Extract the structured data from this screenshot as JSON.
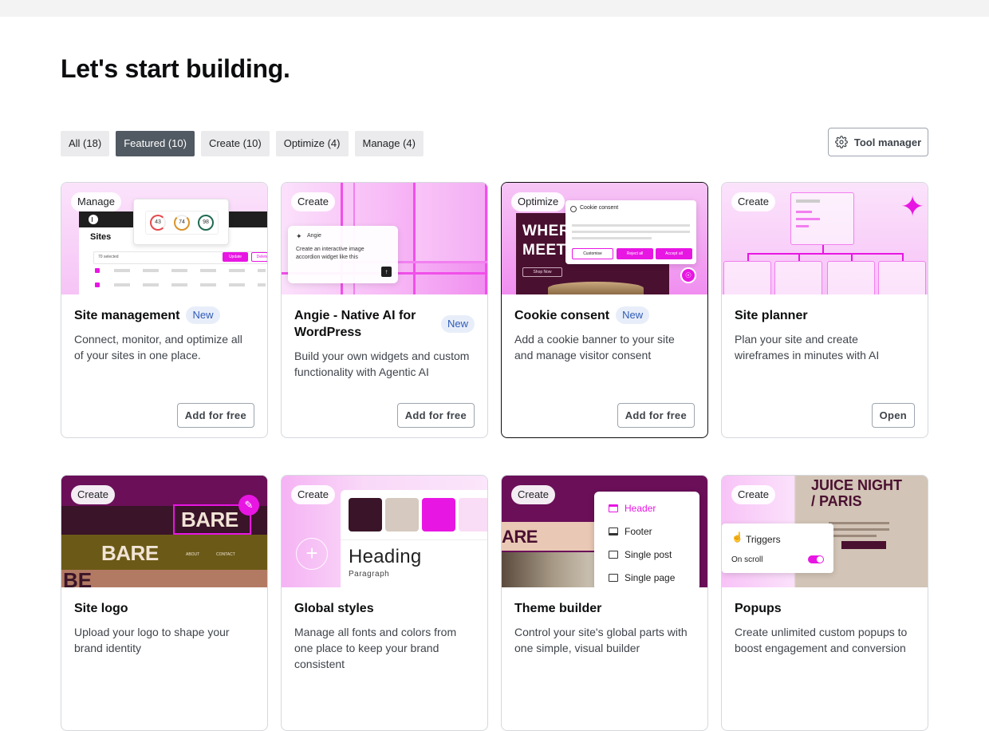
{
  "page": {
    "title": "Let's start building."
  },
  "filters": [
    {
      "label": "All (18)",
      "active": false
    },
    {
      "label": "Featured (10)",
      "active": true
    },
    {
      "label": "Create (10)",
      "active": false
    },
    {
      "label": "Optimize (4)",
      "active": false
    },
    {
      "label": "Manage (4)",
      "active": false
    }
  ],
  "toolbar": {
    "tool_manager_label": "Tool manager"
  },
  "cards": [
    {
      "category": "Manage",
      "title": "Site management",
      "new_label": "New",
      "description": "Connect, monitor, and optimize all of your sites in one place.",
      "action": "Add for free",
      "thumb": {
        "sites_label": "Sites",
        "scores": [
          "43",
          "74",
          "98"
        ],
        "selected_label": "70 selected",
        "update_label": "Update",
        "delete_label": "Delete"
      }
    },
    {
      "category": "Create",
      "title": "Angie - Native AI for WordPress",
      "new_label": "New",
      "description": "Build your own widgets and custom functionality with Agentic AI",
      "action": "Add for free",
      "thumb": {
        "agent_name": "Angie",
        "prompt": "Create an interactive image accordion widget like this"
      }
    },
    {
      "category": "Optimize",
      "title": "Cookie consent",
      "new_label": "New",
      "description": "Add a cookie banner to your site and manage visitor consent",
      "action": "Add for free",
      "thumb": {
        "banner_title": "Cookie consent",
        "customize": "Customise",
        "reject": "Reject all",
        "accept": "Accept all",
        "bg_text_1": "WHER",
        "bg_text_2": "MEET",
        "shop_label": "Shop Now"
      }
    },
    {
      "category": "Create",
      "title": "Site planner",
      "description": "Plan your site and create wireframes in minutes with AI",
      "action": "Open"
    },
    {
      "category": "Create",
      "title": "Site logo",
      "description": "Upload your logo to shape your brand identity",
      "thumb": {
        "logo_1": "BARE",
        "logo_2": "BARE",
        "nav_1": "ABOUT",
        "nav_2": "CONTACT",
        "fragment": "BE"
      }
    },
    {
      "category": "Create",
      "title": "Global styles",
      "description": "Manage all fonts and colors from one place to keep your brand consistent",
      "thumb": {
        "heading": "Heading",
        "paragraph": "Paragraph",
        "swatches": [
          "#3a1428",
          "#d6c9bf",
          "#e816e3",
          "#f9dcf5"
        ]
      }
    },
    {
      "category": "Create",
      "title": "Theme builder",
      "description": "Control your site's global parts with one simple, visual builder",
      "thumb": {
        "items": [
          "Header",
          "Footer",
          "Single post",
          "Single page"
        ],
        "bg_text": "ARE"
      }
    },
    {
      "category": "Create",
      "title": "Popups",
      "description": "Create unlimited custom popups to boost engagement and conversion",
      "thumb": {
        "poster_title_1": "JUICE NIGHT",
        "poster_title_2": "/ PARIS",
        "triggers": "Triggers",
        "on_scroll": "On scroll"
      }
    }
  ],
  "colors": {
    "accent": "#e816e3",
    "filter_active": "#515962",
    "new_pill_bg": "#e8eef9",
    "new_pill_text": "#2f5bb7"
  }
}
